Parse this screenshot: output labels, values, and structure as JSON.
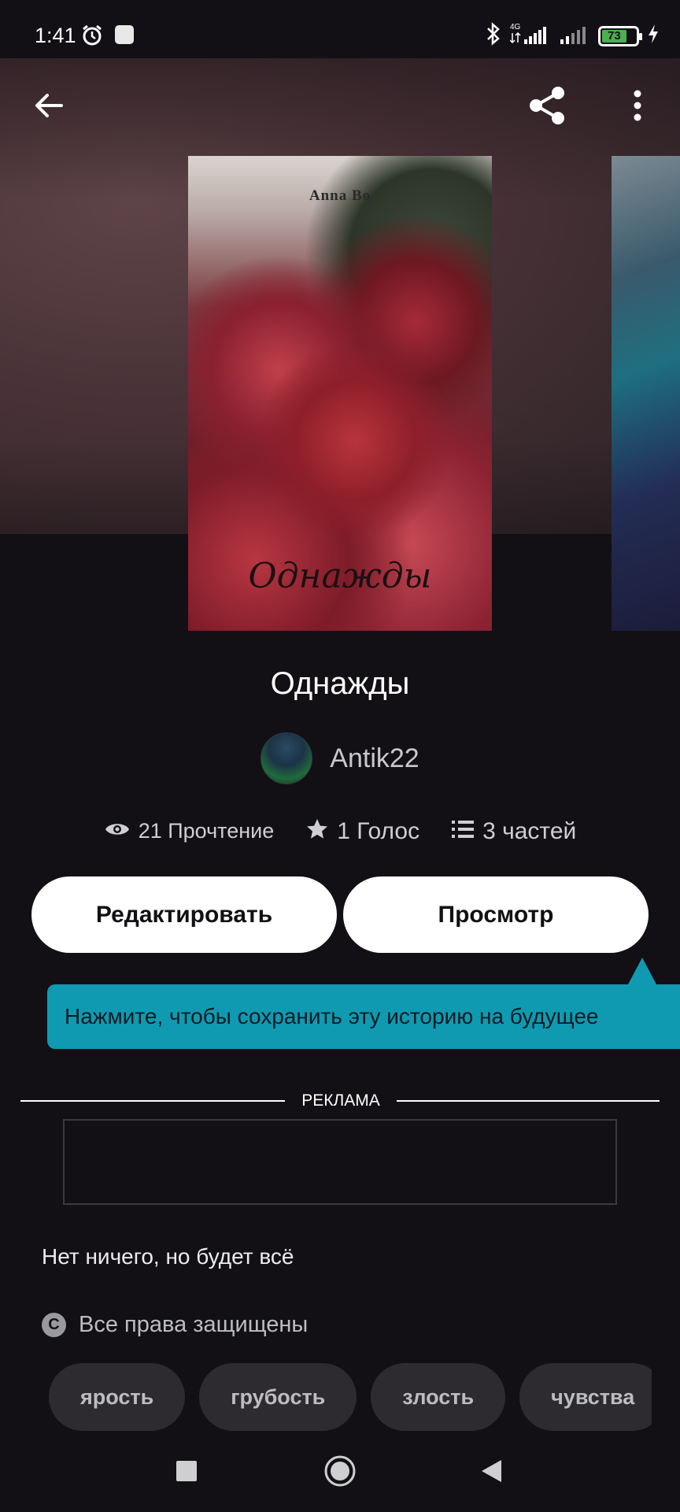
{
  "status_bar": {
    "time": "1:41",
    "battery_level": "73",
    "network": "4G",
    "icons": [
      "alarm-icon",
      "app-notification-icon",
      "bluetooth-icon",
      "signal-icon",
      "battery-icon",
      "charging-icon"
    ]
  },
  "toolbar": {
    "icons": [
      "back-arrow-icon",
      "share-icon",
      "more-vertical-icon"
    ]
  },
  "cover": {
    "author": "Anna Bo",
    "title": "Однажды"
  },
  "story": {
    "title": "Однажды",
    "author": "Antik22"
  },
  "stats": {
    "reads": "21 Прочтение",
    "votes": "1 Голос",
    "parts": "3 частей"
  },
  "actions": {
    "edit_label": "Редактировать",
    "view_label": "Просмотр"
  },
  "tooltip": {
    "text": "Нажмите, чтобы сохранить эту историю на будущее"
  },
  "ad": {
    "label": "РЕКЛАМА"
  },
  "description": "Нет ничего, но будет всё",
  "copyright": "Все права защищены",
  "tags": [
    "ярость",
    "грубость",
    "злость",
    "чувства"
  ],
  "colors": {
    "background": "#121014",
    "tooltip": "#0f9ab2",
    "button": "#ffffff",
    "tag_bg": "#2d2b30",
    "battery": "#4caf50"
  }
}
